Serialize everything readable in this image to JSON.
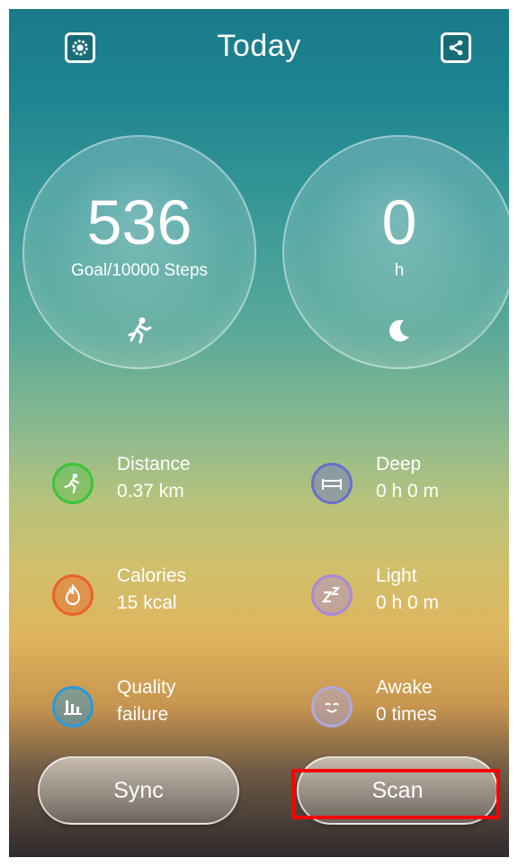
{
  "header": {
    "title": "Today",
    "settings_icon": "gear-icon",
    "share_icon": "share-icon"
  },
  "steps": {
    "value": "536",
    "goal_label": "Goal/10000 Steps",
    "icon": "running-icon"
  },
  "sleep": {
    "value": "0",
    "unit": "h",
    "icon": "moon-icon"
  },
  "stats": {
    "distance": {
      "label": "Distance",
      "value": "0.37 km",
      "icon": "running-icon",
      "color": "#3cc43c"
    },
    "deep": {
      "label": "Deep",
      "value": "0 h 0 m",
      "icon": "bed-icon",
      "color": "#6a70c9"
    },
    "calories": {
      "label": "Calories",
      "value": "15 kcal",
      "icon": "flame-icon",
      "color": "#e8632a"
    },
    "light": {
      "label": "Light",
      "value": "0 h 0 m",
      "icon": "zz-icon",
      "color": "#a88ad8"
    },
    "quality": {
      "label": "Quality",
      "value": "failure",
      "icon": "bar-chart-icon",
      "color": "#2a9ad8"
    },
    "awake": {
      "label": "Awake",
      "value": "0 times",
      "icon": "smile-icon",
      "color": "#b0a8e0"
    }
  },
  "buttons": {
    "sync_label": "Sync",
    "scan_label": "Scan"
  },
  "highlight_color": "#ff0000"
}
